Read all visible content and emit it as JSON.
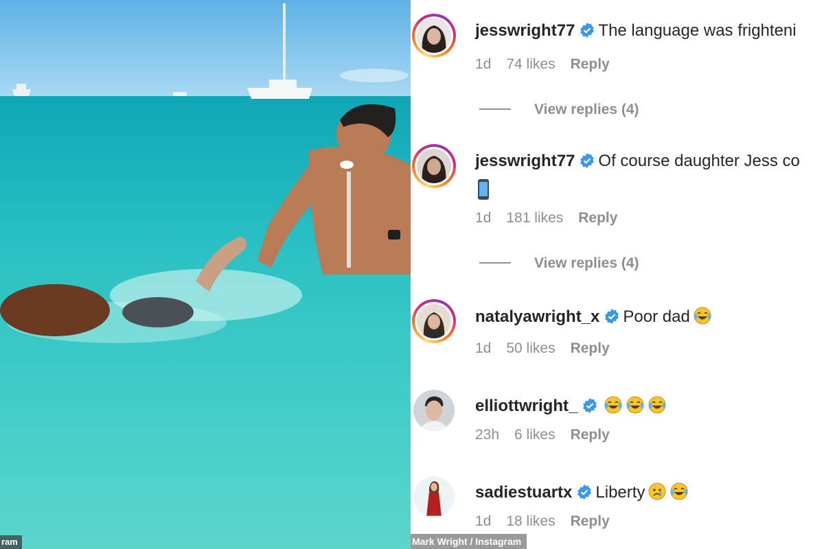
{
  "photo": {
    "credit": "ram"
  },
  "comments_panel": {
    "credit": "Mark Wright / Instagram",
    "items": [
      {
        "username": "jesswright77",
        "text": "The language was frighteni",
        "time": "1d",
        "likes": "74 likes",
        "reply": "Reply",
        "view_replies": "View replies (4)",
        "avatar_icon": "woman-portrait-avatar"
      },
      {
        "username": "jesswright77",
        "text": "Of course daughter Jess co",
        "emoji_line2": "mobile-phone-emoji",
        "time": "1d",
        "likes": "181 likes",
        "reply": "Reply",
        "view_replies": "View replies (4)",
        "avatar_icon": "woman-portrait-avatar"
      },
      {
        "username": "natalyawright_x",
        "text": "Poor dad",
        "emojis": [
          "tears-of-joy-emoji"
        ],
        "time": "1d",
        "likes": "50 likes",
        "reply": "Reply",
        "avatar_icon": "woman-portrait-avatar"
      },
      {
        "username": "elliottwright_",
        "text": "",
        "emojis": [
          "tears-of-joy-emoji",
          "tears-of-joy-emoji",
          "tears-of-joy-emoji"
        ],
        "time": "23h",
        "likes": "6 likes",
        "reply": "Reply",
        "avatar_icon": "man-portrait-avatar"
      },
      {
        "username": "sadiestuartx",
        "text": "Liberty",
        "emojis": [
          "crying-face-emoji",
          "tears-of-joy-emoji"
        ],
        "time": "1d",
        "likes": "18 likes",
        "reply": "Reply",
        "avatar_icon": "woman-red-dress-avatar"
      }
    ]
  },
  "colors": {
    "username": "#262626",
    "meta": "#8e8e8e",
    "verified": "#3897f0",
    "sea": "#2fc4c6",
    "sky": "#7ec6ee"
  }
}
